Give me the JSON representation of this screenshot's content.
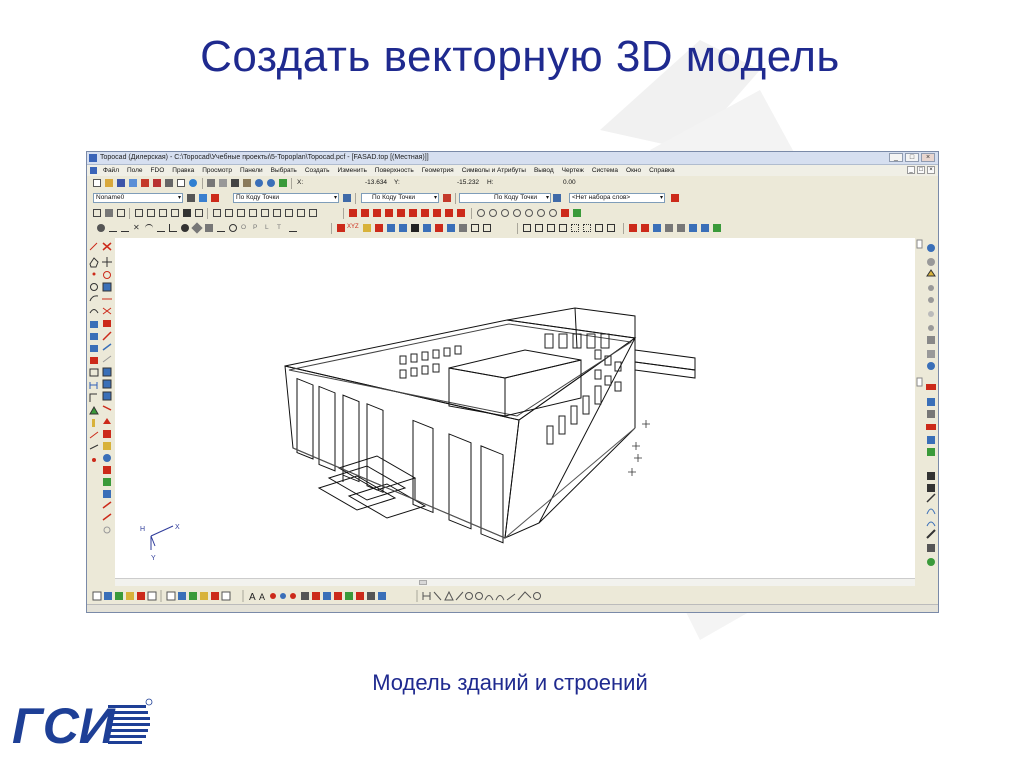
{
  "slide": {
    "title": "Создать векторную 3D модель",
    "caption": "Модель зданий и строений"
  },
  "logo": {
    "text": "ГСИ"
  },
  "window": {
    "title": "Topocad (Дилерская) - C:\\Topocad\\Учебные проекты\\5-Topoplan\\Topocad.pcf - [FASAD.top [(Местная)]]",
    "buttons": [
      "_",
      "□",
      "×"
    ],
    "mdi_buttons": [
      "_",
      "□",
      "×"
    ]
  },
  "menu": {
    "items": [
      "Файл",
      "Поле",
      "FDO",
      "Правка",
      "Просмотр",
      "Панели",
      "Выбрать",
      "Создать",
      "Изменить",
      "Поверхность",
      "Геометрия",
      "Символы и Атрибуты",
      "Вывод",
      "Чертеж",
      "Система",
      "Окно",
      "Справка"
    ]
  },
  "coords": {
    "x_label": "X:",
    "x_value": "-13.634",
    "y_label": "Y:",
    "y_value": "-15.232",
    "h_label": "H:",
    "h_value": "0.00"
  },
  "toolbar2": {
    "layer_select": "Noname0",
    "code_select": "По Коду Точки",
    "line_code_select": "По Коду Точки",
    "style_select": "По Коду Точки",
    "words_select": "<Нет набора слов>"
  },
  "toolbar4": {
    "letters": [
      "O",
      "P",
      "L",
      "T"
    ],
    "xyz_label": "XYZ"
  },
  "axis": {
    "h_label": "H",
    "x_label": "X",
    "y_label": "Y"
  },
  "colors": {
    "title_blue": "#1f2a8f",
    "logo_blue": "#1e3f96",
    "icon_red": "#cc2a1a",
    "icon_blue": "#2f5fb8"
  }
}
